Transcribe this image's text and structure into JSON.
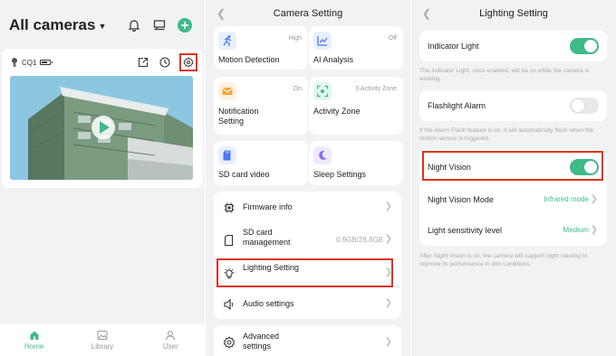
{
  "home": {
    "title": "All cameras",
    "camera_name": "CQ1",
    "tabs": [
      {
        "label": "Home",
        "icon": "home-icon",
        "active": true
      },
      {
        "label": "Library",
        "icon": "image-icon",
        "active": false
      },
      {
        "label": "User",
        "icon": "user-icon",
        "active": false
      }
    ]
  },
  "camera_setting": {
    "title": "Camera Setting",
    "tiles": [
      {
        "label": "Motion Detection",
        "value": "High",
        "icon": "running-person-icon"
      },
      {
        "label": "AI Analysis",
        "value": "Off",
        "icon": "chart-icon"
      },
      {
        "label": "Notification Setting",
        "value": "On",
        "icon": "mail-icon"
      },
      {
        "label": "Activity Zone",
        "value": "0 Activity Zone",
        "icon": "zone-icon"
      },
      {
        "label": "SD card video",
        "value": "",
        "icon": "sd-card-icon"
      },
      {
        "label": "Sleep Settings",
        "value": "",
        "icon": "moon-icon"
      }
    ],
    "rows": [
      {
        "label": "Firmware info",
        "value": "",
        "icon": "chip-icon"
      },
      {
        "label": "SD card management",
        "value": "0.9GB/28.8GB",
        "icon": "sd-card-outline-icon"
      },
      {
        "label": "Lighting Setting",
        "value": "",
        "icon": "bulb-icon"
      },
      {
        "label": "Audio settings",
        "value": "",
        "icon": "speaker-icon"
      },
      {
        "label": "Advanced settings",
        "value": "",
        "icon": "gear-icon"
      }
    ]
  },
  "lighting_setting": {
    "title": "Lighting Setting",
    "indicator_light": {
      "label": "Indicator Light",
      "on": true,
      "hint": "The Indicator Light, once enabled, will be on while the camera is working."
    },
    "flashlight_alarm": {
      "label": "Flashlight Alarm",
      "on": false,
      "hint": "If the Alarm Flash feature is on, it will automatically flash when the motion sensor is triggered."
    },
    "night_vision": {
      "label": "Night Vision",
      "on": true
    },
    "night_vision_mode": {
      "label": "Night Vision Mode",
      "value": "Infrared mode"
    },
    "light_sensitivity": {
      "label": "Light sensitivity level",
      "value": "Medium"
    },
    "night_hint": "After Night Vision is on, the camera will support night viewing to improve its performance in dim conditions."
  },
  "colors": {
    "accent": "#3fba8a",
    "highlight": "#e0321c"
  }
}
